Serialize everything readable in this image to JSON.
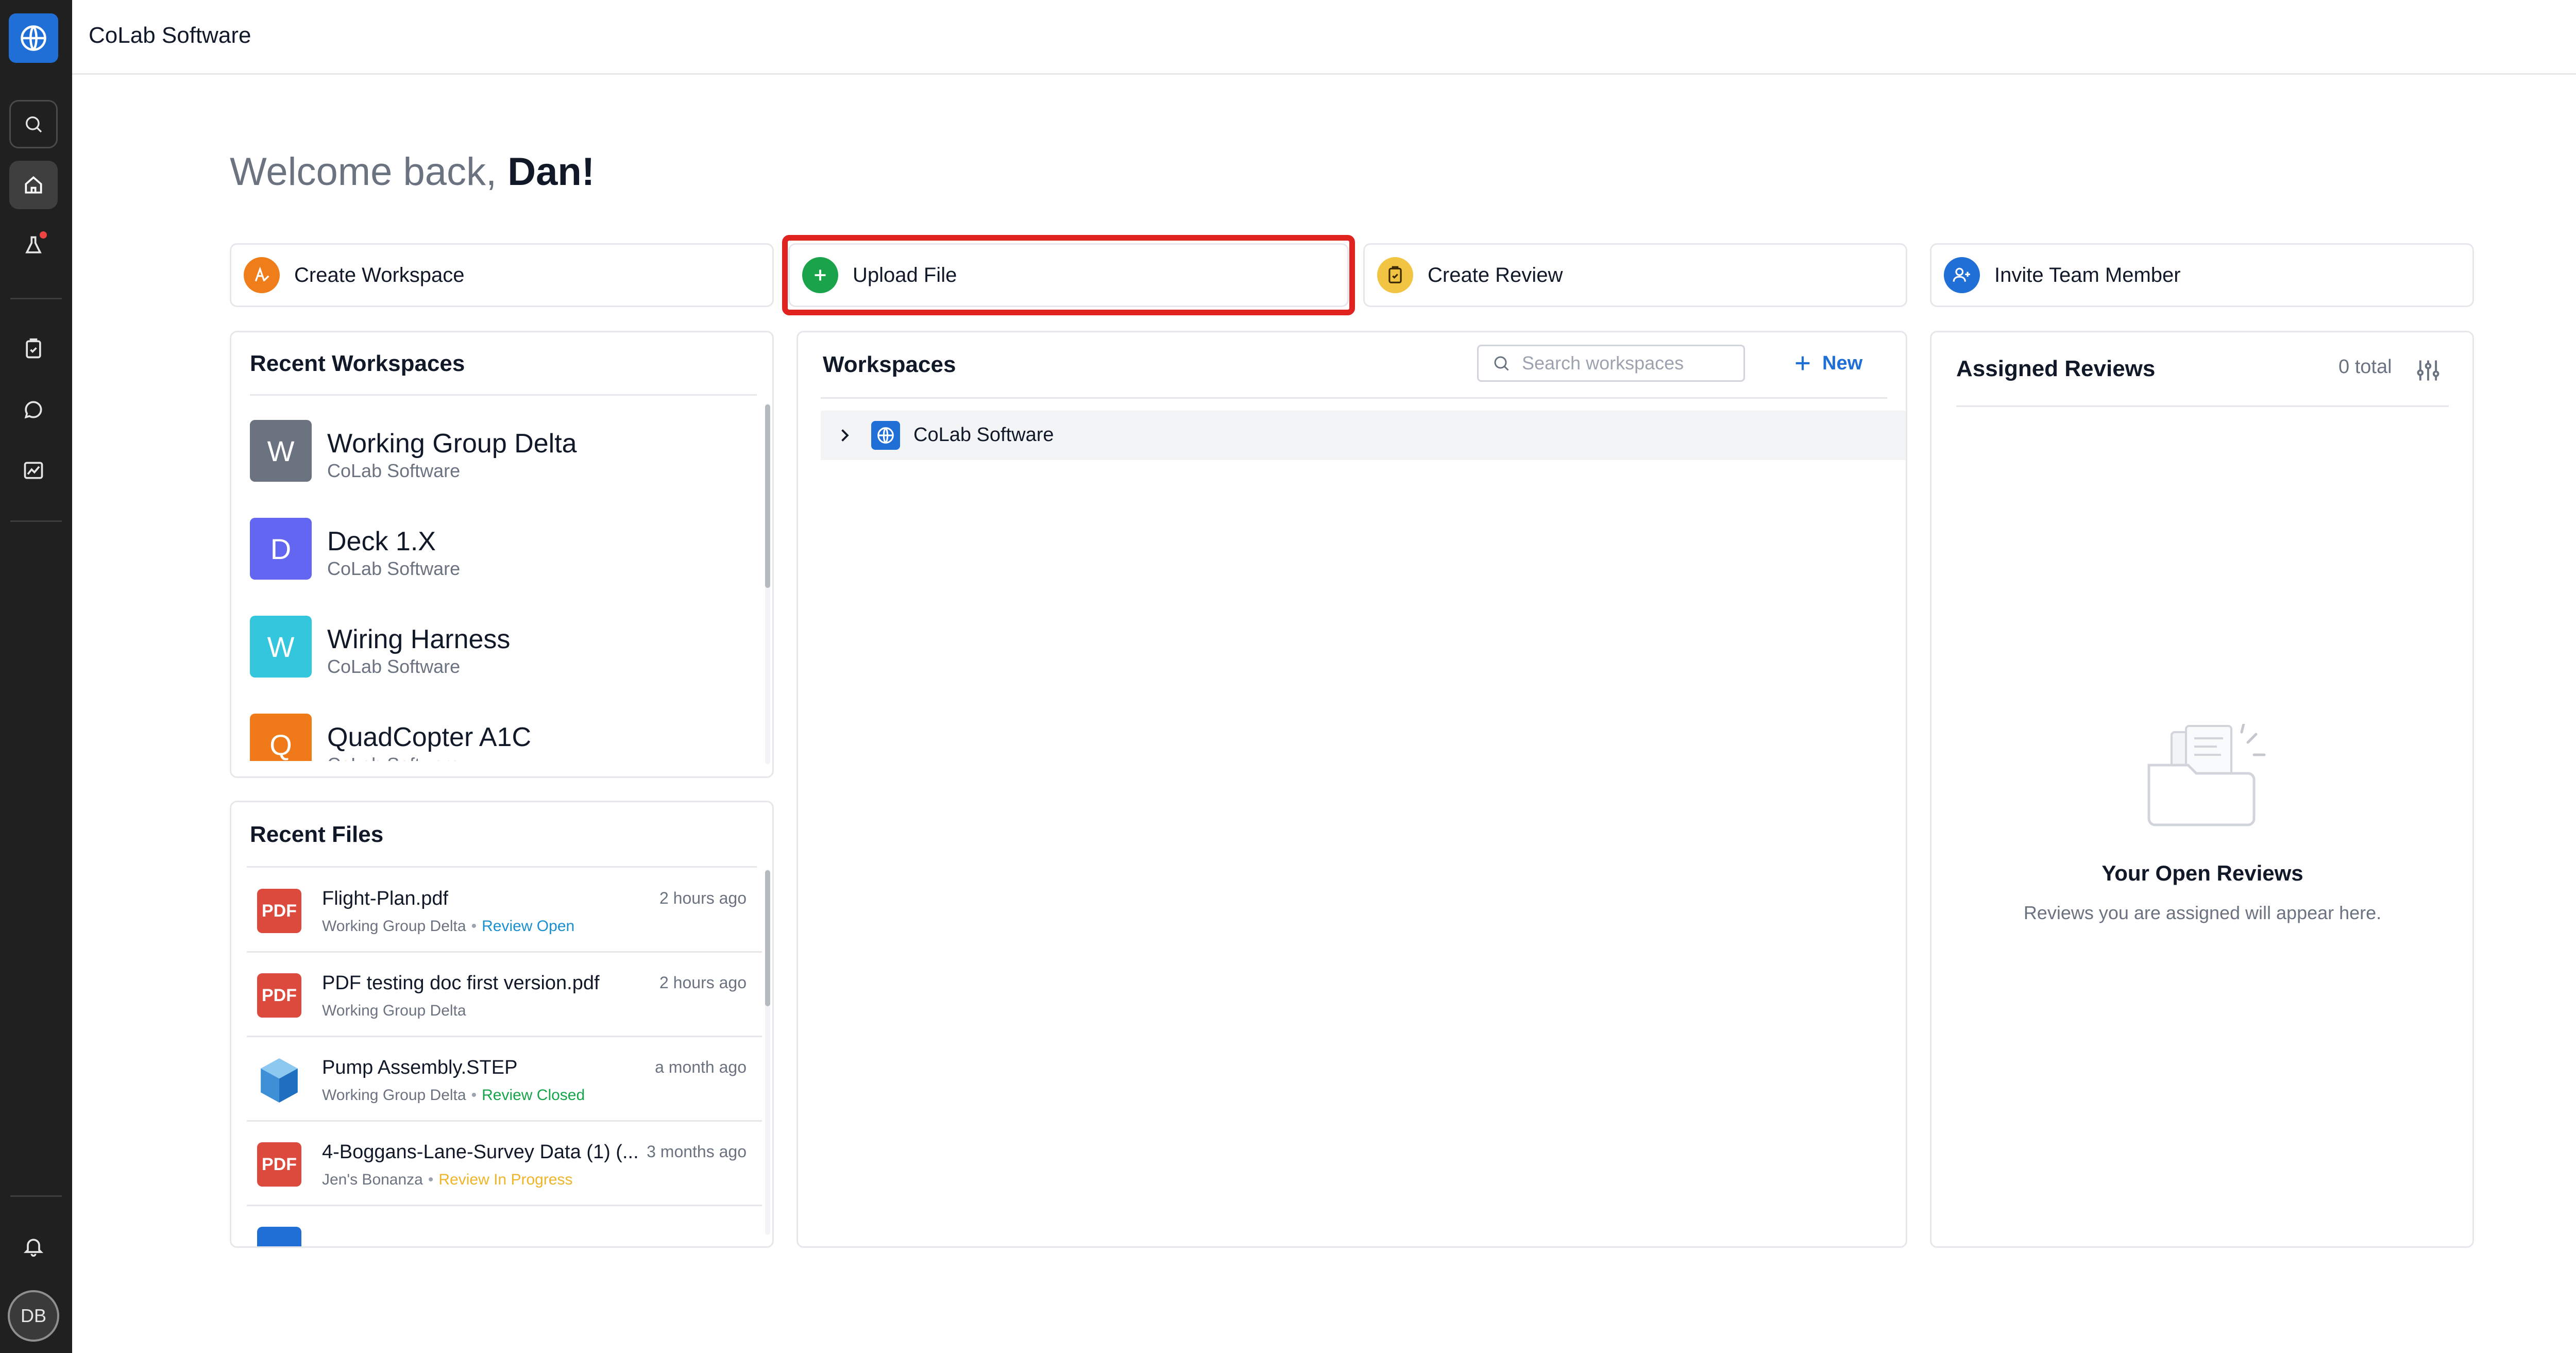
{
  "app": {
    "title": "CoLab Software"
  },
  "user": {
    "initials": "DB"
  },
  "welcome": {
    "greeting": "Welcome back,",
    "name": "Dan!"
  },
  "actions": [
    {
      "label": "Create Workspace",
      "icon": "workspace-pen-icon",
      "color": "#ef7d1a"
    },
    {
      "label": "Upload File",
      "icon": "plus-icon",
      "color": "#1aa34a"
    },
    {
      "label": "Create Review",
      "icon": "review-clipboard-icon",
      "color": "#f2c443"
    },
    {
      "label": "Invite Team Member",
      "icon": "add-user-icon",
      "color": "#1f6fd6"
    }
  ],
  "recent_workspaces": {
    "title": "Recent Workspaces",
    "items": [
      {
        "initial": "W",
        "name": "Working Group Delta",
        "org": "CoLab Software",
        "color": "#6b7280"
      },
      {
        "initial": "D",
        "name": "Deck 1.X",
        "org": "CoLab Software",
        "color": "#6366f1"
      },
      {
        "initial": "W",
        "name": "Wiring Harness",
        "org": "CoLab Software",
        "color": "#34c6dc"
      },
      {
        "initial": "Q",
        "name": "QuadCopter A1C",
        "org": "CoLab Software",
        "color": "#f07a1a"
      }
    ]
  },
  "recent_files": {
    "title": "Recent Files",
    "items": [
      {
        "name": "Flight-Plan.pdf",
        "workspace": "Working Group Delta",
        "status": "Review Open",
        "time": "2 hours ago",
        "type": "PDF"
      },
      {
        "name": "PDF testing doc first version.pdf",
        "workspace": "Working Group Delta",
        "status": "",
        "time": "2 hours ago",
        "type": "PDF"
      },
      {
        "name": "Pump Assembly.STEP",
        "workspace": "Working Group Delta",
        "status": "Review Closed",
        "time": "a month ago",
        "type": "STEP"
      },
      {
        "name": "4-Boggans-Lane-Survey Data (1) (...",
        "workspace": "Jen's Bonanza",
        "status": "Review In Progress",
        "time": "3 months ago",
        "type": "PDF"
      }
    ]
  },
  "workspaces": {
    "title": "Workspaces",
    "search_placeholder": "Search workspaces",
    "new_label": "New",
    "tree": [
      {
        "name": "CoLab Software"
      }
    ]
  },
  "assigned_reviews": {
    "title": "Assigned Reviews",
    "count": "0 total",
    "empty_title": "Your Open Reviews",
    "empty_subtitle": "Reviews you are assigned will appear here."
  },
  "colors": {
    "accent": "#1f6fd6",
    "highlight": "#e0231e",
    "rail": "#202020"
  }
}
